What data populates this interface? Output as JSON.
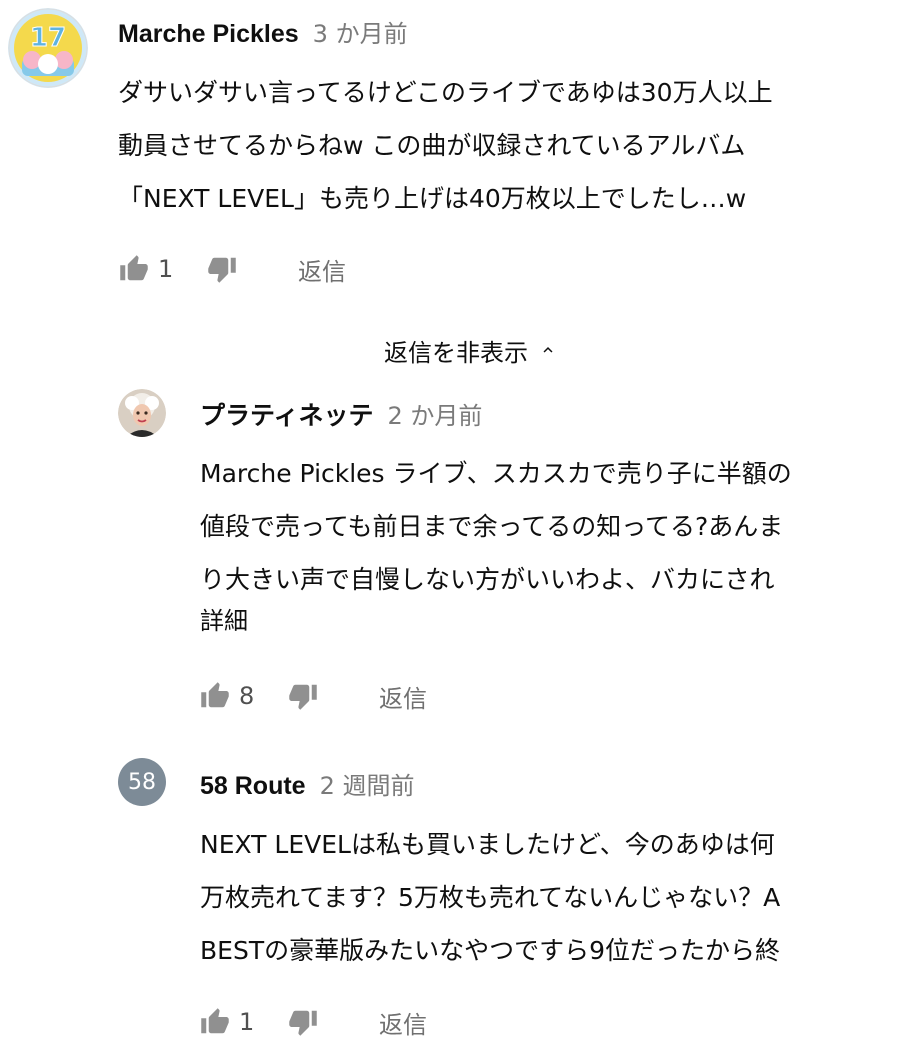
{
  "thread": {
    "comment": {
      "author": "Marche Pickles",
      "time": "3 か月前",
      "avatar_icon": "avatar-17-badge",
      "lines": [
        "ダサいダサい言ってるけどこのライブであゆは30万人以上",
        "動員させてるからねw この曲が収録されているアルバム",
        "「NEXT LEVEL」も売り上げは40万枚以上でしたし…w"
      ],
      "likes": "1",
      "reply_label": "返信"
    },
    "hide_replies_label": "返信を非表示",
    "replies": [
      {
        "author": "プラティネッテ",
        "time": "2 か月前",
        "avatar_icon": "avatar-photo",
        "lines": [
          "Marche Pickles ライブ、スカスカで売り子に半額の",
          "値段で売っても前日まで余ってるの知ってる?あんま",
          "り大きい声で自慢しない方がいいわよ、バカにされ"
        ],
        "read_more": "詳細",
        "likes": "8",
        "reply_label": "返信"
      },
      {
        "author": "58 Route",
        "time": "2 週間前",
        "avatar_text": "58",
        "lines": [
          "NEXT LEVELは私も買いましたけど、今のあゆは何",
          "万枚売れてます？5万枚も売れてないんじゃない？A",
          "BESTの豪華版みたいなやつですら9位だったから終"
        ],
        "likes": "1",
        "reply_label": "返信"
      }
    ]
  },
  "colors": {
    "text": "#0f0f0f",
    "secondary": "#7a7a7a",
    "icon": "#909090",
    "avatar_letter_bg": "#7d8b97"
  }
}
